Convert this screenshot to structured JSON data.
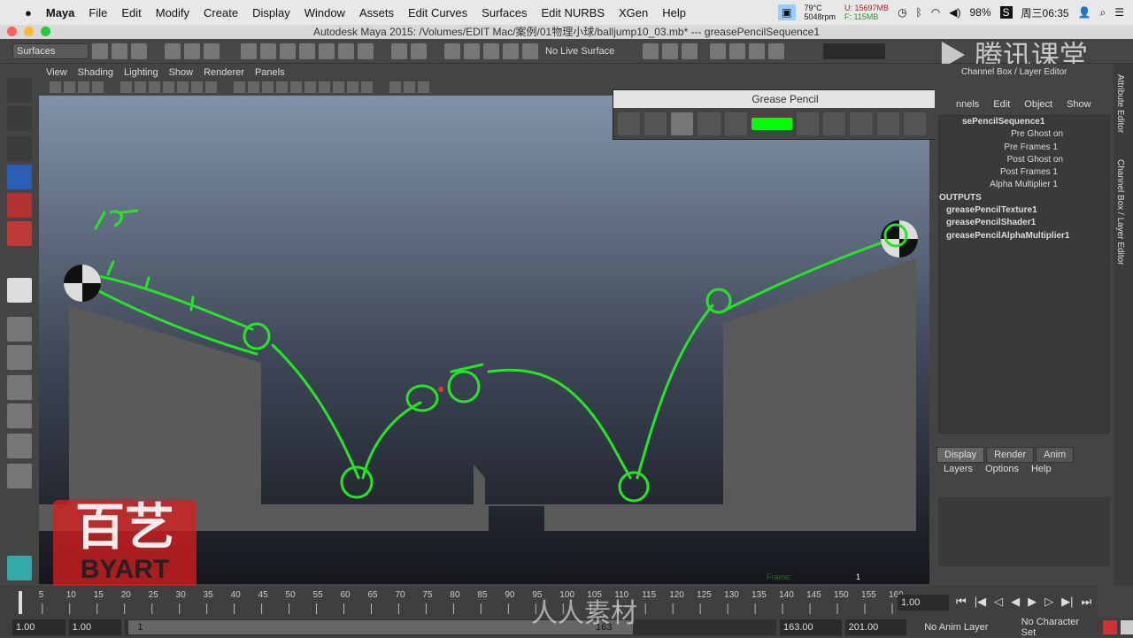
{
  "menubar": {
    "apple": "",
    "items": [
      "Maya",
      "File",
      "Edit",
      "Modify",
      "Create",
      "Display",
      "Window",
      "Assets",
      "Edit Curves",
      "Surfaces",
      "Edit NURBS",
      "XGen",
      "Help"
    ],
    "temp": "79°C",
    "rpm": "5048rpm",
    "mem_used": "U: 15697MB",
    "mem_free": "F: 115MB",
    "battery": "98%",
    "clock": "周三06:35"
  },
  "window": {
    "title": "Autodesk Maya 2015: /Volumes/EDIT Mac/案例/01物理小球/balljump10_03.mb*   ---   greasePencilSequence1"
  },
  "shelf": {
    "mode": "Surfaces",
    "live_surface": "No Live Surface"
  },
  "viewport": {
    "menu": [
      "View",
      "Shading",
      "Lighting",
      "Show",
      "Renderer",
      "Panels"
    ],
    "frame_label": "Frame:",
    "frame_value": "1",
    "accent": "#22e822"
  },
  "grease_pencil": {
    "title": "Grease Pencil",
    "color": "#00ff00"
  },
  "channel_box": {
    "title": "Channel Box / Layer Editor",
    "menu": [
      "nnels",
      "Edit",
      "Object",
      "Show"
    ],
    "node": "sePencilSequence1",
    "attrs": [
      "Pre Ghost on",
      "Pre Frames 1",
      "Post Ghost on",
      "Post Frames 1",
      "Alpha Multiplier 1"
    ],
    "outputs_label": "OUTPUTS",
    "outputs": [
      "greasePencilTexture1",
      "greasePencilShader1",
      "greasePencilAlphaMultiplier1"
    ]
  },
  "layer_editor": {
    "tabs": [
      "Display",
      "Render",
      "Anim"
    ],
    "menu": [
      "Layers",
      "Options",
      "Help"
    ]
  },
  "side_tabs": [
    "Attribute Editor",
    "Channel Box / Layer Editor"
  ],
  "timeline": {
    "ticks": [
      5,
      10,
      15,
      20,
      25,
      30,
      35,
      40,
      45,
      50,
      55,
      60,
      65,
      70,
      75,
      80,
      85,
      90,
      95,
      100,
      105,
      110,
      115,
      120,
      125,
      130,
      135,
      140,
      145,
      150,
      155,
      160
    ],
    "current_frame": "1.00"
  },
  "range": {
    "start": "1.00",
    "playback_start": "1.00",
    "slider_start": "1",
    "slider_end": "163",
    "playback_end": "163.00",
    "end": "201.00",
    "anim_layer": "No Anim Layer",
    "character_set": "No Character Set"
  },
  "watermarks": {
    "top": "腾讯课堂",
    "logo": "百艺 BYART",
    "bottom": "人人素材"
  }
}
